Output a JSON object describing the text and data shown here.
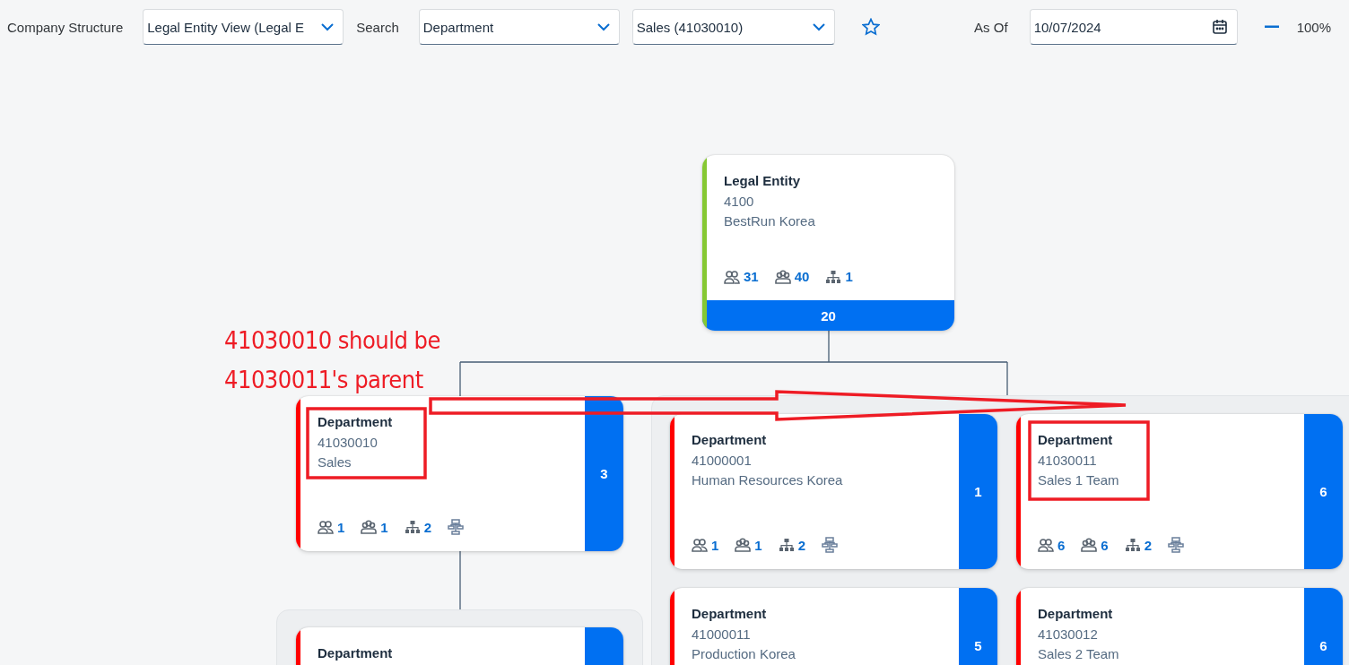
{
  "toolbar": {
    "company_structure": {
      "label": "Company Structure",
      "value": "Legal Entity View (Legal E"
    },
    "search": {
      "label": "Search",
      "type_value": "Department",
      "item_value": "Sales (41030010)"
    },
    "as_of": {
      "label": "As Of",
      "value": "10/07/2024"
    },
    "zoom": "100%"
  },
  "nodes": [
    {
      "kind": "entity",
      "color": "#86c833",
      "type": "Legal Entity",
      "code": "4100",
      "name": "BestRun Korea",
      "stats": [
        "31",
        "40",
        "1"
      ],
      "count": "20"
    },
    {
      "kind": "department",
      "color": "#ff0000",
      "type": "Department",
      "code": "41030010",
      "name": "Sales",
      "stats": [
        "1",
        "1",
        "2"
      ],
      "count": "3"
    },
    {
      "kind": "department",
      "color": "#ff0000",
      "type": "Department",
      "code": "41000001",
      "name": "Human Resources Korea",
      "stats": [
        "1",
        "1",
        "2"
      ],
      "count": "1"
    },
    {
      "kind": "department",
      "color": "#ff0000",
      "type": "Department",
      "code": "41030011",
      "name": "Sales 1 Team",
      "stats": [
        "6",
        "6",
        "2"
      ],
      "count": "6"
    },
    {
      "kind": "department",
      "color": "#ff0000",
      "type": "Department"
    },
    {
      "kind": "department",
      "color": "#ff0000",
      "type": "Department",
      "code": "41000011",
      "name": "Production Korea",
      "count": "5"
    },
    {
      "kind": "department",
      "color": "#ff0000",
      "type": "Department",
      "code": "41030012",
      "name": "Sales 2 Team",
      "count": "6"
    }
  ],
  "annotation": {
    "lines": [
      "41030010 should be",
      "41030011's parent"
    ]
  }
}
